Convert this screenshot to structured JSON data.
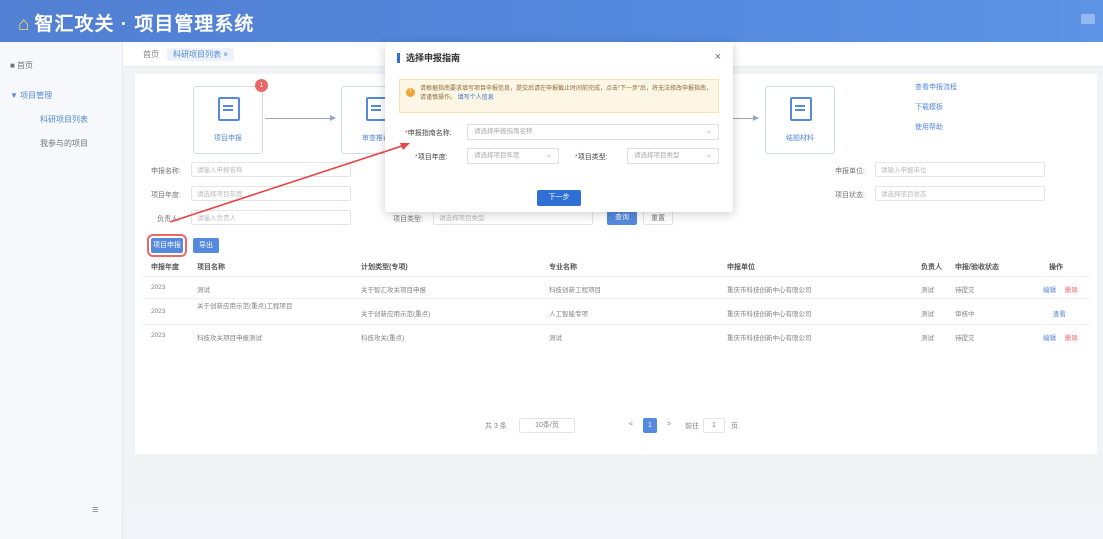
{
  "app": {
    "logo_mark": "⌂",
    "title": "智汇攻关 · 项目管理系统"
  },
  "sidebar": {
    "items": [
      {
        "label": "■ 首页"
      },
      {
        "label": "▼ 项目管理"
      },
      {
        "label": "科研项目列表"
      },
      {
        "label": "我参与的项目"
      }
    ],
    "collapse_icon": "≡"
  },
  "tabs": [
    {
      "label": "首页"
    },
    {
      "label": "科研项目列表 ×"
    }
  ],
  "steps": [
    {
      "label": "项目申报",
      "badge": "1"
    },
    {
      "label": "审查推荐"
    },
    {
      "label": "结题材料"
    }
  ],
  "side_links": [
    "查看申报流程",
    "下载模板",
    "使用帮助"
  ],
  "filter": {
    "label_name": "申报名称:",
    "ph_name": "请输入申报名称",
    "label_year": "项目年度:",
    "ph_year": "请选择项目年度",
    "label_leader": "负责人:",
    "ph_leader": "请输入负责人",
    "label_type": "项目类型:",
    "ph_type": "请选择项目类型",
    "label_unit": "申报单位:",
    "ph_unit": "请输入申报单位",
    "label_status": "项目状态:",
    "ph_status": "请选择项目状态",
    "search": "查询",
    "reset": "重置"
  },
  "actions": {
    "new": "项目申报",
    "export": "导出"
  },
  "table": {
    "headers": [
      "申报年度",
      "项目名称",
      "计划类型(专项)",
      "专业名称",
      "申报单位",
      "负责人",
      "申报/验收状态",
      "操作"
    ],
    "rows": [
      {
        "year": "2023",
        "name": "测试",
        "plan": "关于智汇攻关项目申报",
        "major": "科技创新工程项目",
        "unit": "重庆市科技创新中心有限公司",
        "leader": "测试",
        "status": "待提交",
        "op1": "编辑",
        "op2": "删除"
      },
      {
        "year": "2023",
        "name": "关于创新应用示范(重点)工程项目",
        "plan": "关于创新应用示范(重点)",
        "major": "人工智能专项",
        "unit": "重庆市科技创新中心有限公司",
        "leader": "测试",
        "status": "审核中",
        "op1": "查看",
        "op2": ""
      },
      {
        "year": "2023",
        "name": "科技攻关项目申报测试",
        "plan": "科技攻关(重点)",
        "major": "测试",
        "unit": "重庆市科技创新中心有限公司",
        "leader": "测试",
        "status": "待提交",
        "op1": "编辑",
        "op2": "删除"
      }
    ]
  },
  "pager": {
    "total": "共 3 条",
    "size": "10条/页",
    "prev": "<",
    "page": "1",
    "next": ">",
    "goto": "前往",
    "goto_val": "1",
    "unit": "页"
  },
  "modal": {
    "title": "选择申报指南",
    "close": "×",
    "tip_icon": "!",
    "tip": "请根据指南要求填写项目申报信息，提交后请在申报截止时间前完成，点击“下一步”后，将无法修改申报指南，请谨慎操作。",
    "tip_link": "填写个人信息",
    "guide_label": "申报指南名称:",
    "guide_ph": "请选择申报指南名称",
    "year_label": "项目年度:",
    "year_ph": "请选择项目年度",
    "type_label": "项目类型:",
    "type_ph": "请选择项目类型",
    "chevron": "⌄",
    "next": "下一步"
  },
  "colors": {
    "primary": "#2f6fd6",
    "danger": "#e84545",
    "topbar": "#2c64c9"
  }
}
